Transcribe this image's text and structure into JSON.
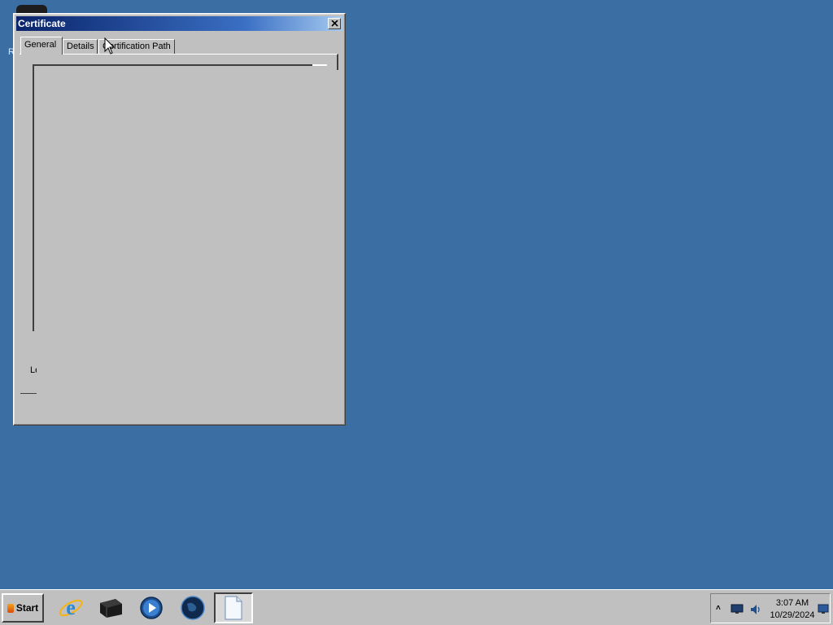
{
  "dialog": {
    "title": "Certificate",
    "close_glyph": "close-icon",
    "tabs": [
      {
        "label": "General",
        "active": true
      },
      {
        "label": "Details",
        "active": false
      },
      {
        "label": "Certification Path",
        "active": false
      }
    ],
    "partial_label": "Le"
  },
  "desktop": {
    "partial_letter": "R"
  },
  "taskbar": {
    "start_label": "Start",
    "pinned": [
      "internet-explorer-icon",
      "black-device-icon",
      "media-player-icon",
      "globe-icon",
      "document-icon"
    ],
    "tray": {
      "time": "3:07 AM",
      "date": "10/29/2024",
      "icons": [
        "show-hidden-icons-chevron",
        "network-monitor-icon",
        "speaker-icon",
        "action-center-icon"
      ]
    }
  },
  "colors": {
    "desktop": "#3b6ea3",
    "titlebar_start": "#0a246a",
    "titlebar_end": "#a6caf0",
    "window_face": "#c0c0c0"
  }
}
